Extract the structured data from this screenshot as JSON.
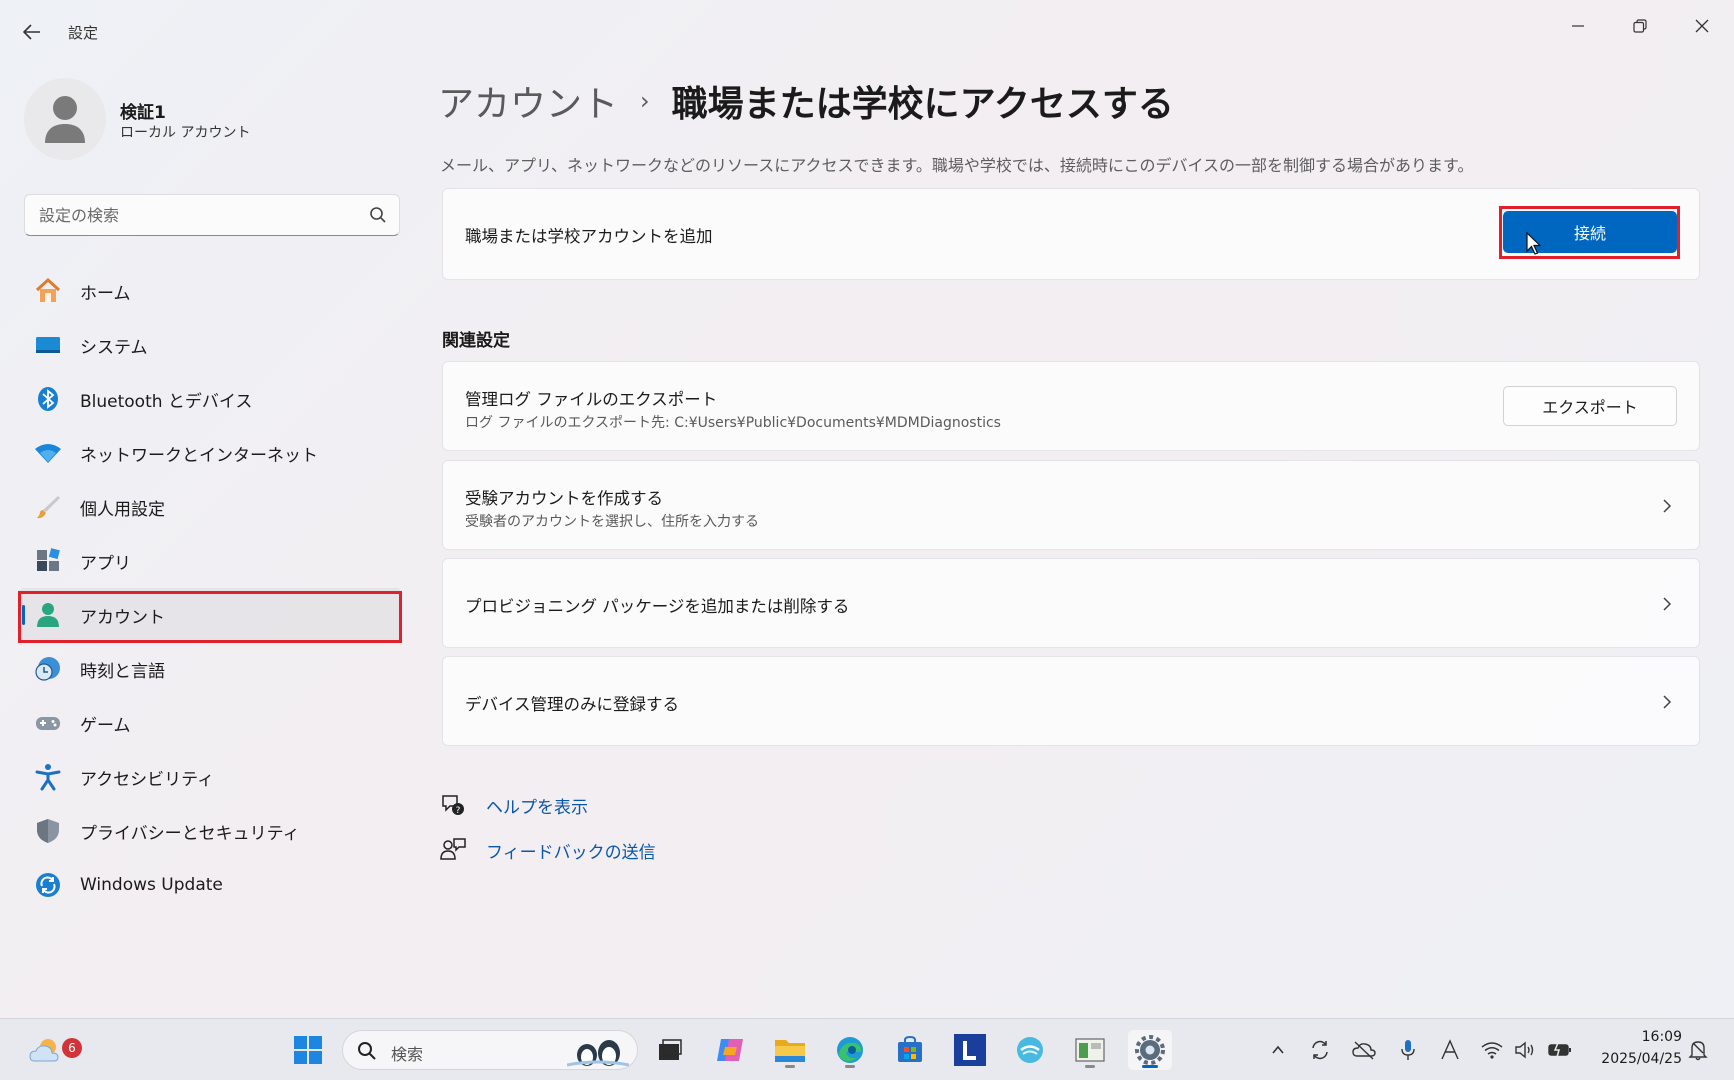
{
  "window": {
    "title": "設定"
  },
  "profile": {
    "name": "検証1",
    "account_type": "ローカル アカウント"
  },
  "search": {
    "placeholder": "設定の検索"
  },
  "sidebar": {
    "items": [
      {
        "label": "ホーム",
        "icon": "home-icon"
      },
      {
        "label": "システム",
        "icon": "system-icon"
      },
      {
        "label": "Bluetooth とデバイス",
        "icon": "bluetooth-icon"
      },
      {
        "label": "ネットワークとインターネット",
        "icon": "wifi-icon"
      },
      {
        "label": "個人用設定",
        "icon": "brush-icon"
      },
      {
        "label": "アプリ",
        "icon": "apps-icon"
      },
      {
        "label": "アカウント",
        "icon": "person-icon",
        "active": true
      },
      {
        "label": "時刻と言語",
        "icon": "time-language-icon"
      },
      {
        "label": "ゲーム",
        "icon": "gamepad-icon"
      },
      {
        "label": "アクセシビリティ",
        "icon": "accessibility-icon"
      },
      {
        "label": "プライバシーとセキュリティ",
        "icon": "shield-icon"
      },
      {
        "label": "Windows Update",
        "icon": "update-icon"
      }
    ]
  },
  "main": {
    "breadcrumb_parent": "アカウント",
    "breadcrumb_separator": "›",
    "title": "職場または学校にアクセスする",
    "description": "メール、アプリ、ネットワークなどのリソースにアクセスできます。職場や学校では、接続時にこのデバイスの一部を制御する場合があります。",
    "add_account": {
      "label": "職場または学校アカウントを追加",
      "button": "接続"
    },
    "related_heading": "関連設定",
    "export_logs": {
      "title": "管理ログ ファイルのエクスポート",
      "subtitle": "ログ ファイルのエクスポート先: C:¥Users¥Public¥Documents¥MDMDiagnostics",
      "button": "エクスポート"
    },
    "exam_account": {
      "title": "受験アカウントを作成する",
      "subtitle": "受験者のアカウントを選択し、住所を入力する"
    },
    "provisioning": {
      "title": "プロビジョニング パッケージを追加または削除する"
    },
    "device_management": {
      "title": "デバイス管理のみに登録する"
    },
    "help": {
      "label": "ヘルプを表示"
    },
    "feedback": {
      "label": "フィードバックの送信"
    }
  },
  "taskbar": {
    "search_label": "検索",
    "weather_badge": "6",
    "time": "16:09",
    "date": "2025/04/25"
  },
  "colors": {
    "accent": "#0067c0",
    "highlight": "#e0202a",
    "link": "#0a56a8"
  }
}
